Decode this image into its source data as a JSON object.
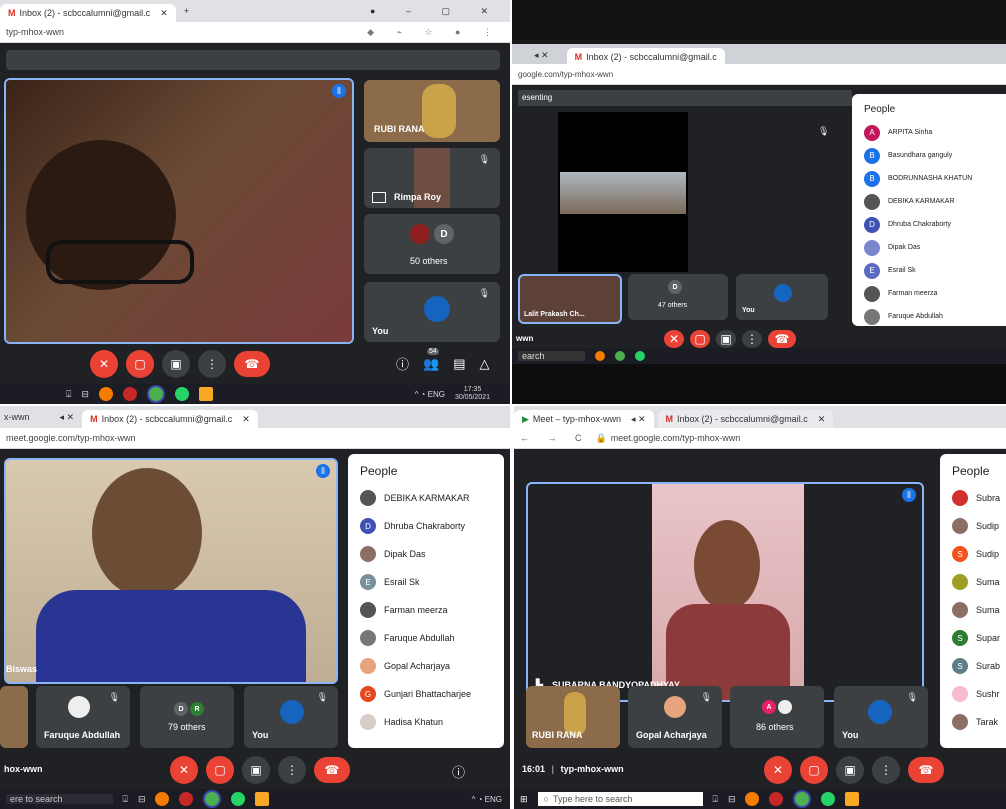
{
  "q1": {
    "tab_label": "Inbox (2) - scbccalumni@gmail.c",
    "tab_add": "+",
    "url": "typ-mhox-wwn",
    "tiles": [
      {
        "name": "RUBI RANA"
      },
      {
        "name": "Rimpa Roy"
      },
      {
        "name": "50 others",
        "avatar_letter": "D"
      },
      {
        "name": "You"
      }
    ],
    "people_badge": "54",
    "clock_time": "17:35",
    "clock_date": "30/05/2021"
  },
  "q2": {
    "tab_label": "Inbox (2) - scbccalumni@gmail.c",
    "url": "google.com/typ-mhox-wwn",
    "presenting": "esenting",
    "tiles": [
      {
        "name": "Lalit Prakash Ch..."
      },
      {
        "name": "47 others",
        "avatar_letter": "D"
      },
      {
        "name": "You"
      }
    ],
    "meeting_code": "wwn",
    "search": "earch",
    "people_title": "People",
    "people": [
      {
        "name": "ARPITA Sinha",
        "letter": "A",
        "color": "#c2185b"
      },
      {
        "name": "Basundhara ganguly",
        "letter": "B",
        "color": "#1a73e8"
      },
      {
        "name": "BODRUNNASHA KHATUN",
        "letter": "B",
        "color": "#1a73e8"
      },
      {
        "name": "DEBIKA KARMAKAR",
        "letter": "",
        "color": "#555555"
      },
      {
        "name": "Dhruba Chakraborty",
        "letter": "D",
        "color": "#3f51b5"
      },
      {
        "name": "Dipak Das",
        "letter": "",
        "color": "#7986cb"
      },
      {
        "name": "Esrail Sk",
        "letter": "E",
        "color": "#5c6bc0"
      },
      {
        "name": "Farman meerza",
        "letter": "",
        "color": "#555555"
      },
      {
        "name": "Faruque Abdullah",
        "letter": "",
        "color": "#777777"
      }
    ]
  },
  "q3": {
    "tab_label_left": "x-wwn",
    "tab_label": "Inbox (2) - scbccalumni@gmail.c",
    "url": "meet.google.com/typ-mhox-wwn",
    "main_name": "Biswas",
    "tiles": [
      {
        "name": "Faruque Abdullah"
      },
      {
        "name": "79 others",
        "avatar_letters": [
          "D",
          "R"
        ]
      },
      {
        "name": "You"
      }
    ],
    "meeting_code": "hox-wwn",
    "search": "ere to search",
    "people_title": "People",
    "people": [
      {
        "name": "DEBIKA KARMAKAR",
        "letter": "",
        "color": "#555555"
      },
      {
        "name": "Dhruba Chakraborty",
        "letter": "D",
        "color": "#3f51b5"
      },
      {
        "name": "Dipak Das",
        "letter": "",
        "color": "#8d6e63"
      },
      {
        "name": "Esrail Sk",
        "letter": "E",
        "color": "#78909c"
      },
      {
        "name": "Farman meerza",
        "letter": "",
        "color": "#555555"
      },
      {
        "name": "Faruque Abdullah",
        "letter": "",
        "color": "#777777"
      },
      {
        "name": "Gopal Acharjaya",
        "letter": "",
        "color": "#e6a57e"
      },
      {
        "name": "Gunjari Bhattacharjee",
        "letter": "G",
        "color": "#e8471d"
      },
      {
        "name": "Hadisa Khatun",
        "letter": "",
        "color": "#d7ccc8"
      }
    ]
  },
  "q4": {
    "tab_label_meet": "Meet – typ-mhox-wwn",
    "tab_label": "Inbox (2) - scbccalumni@gmail.c",
    "url": "meet.google.com/typ-mhox-wwn",
    "main_name": "SUBARNA BANDYOPADHYAY",
    "tiles": [
      {
        "name": "RUBI RANA"
      },
      {
        "name": "Gopal Acharjaya"
      },
      {
        "name": "86 others",
        "avatar_letter": "A"
      },
      {
        "name": "You"
      }
    ],
    "time": "16:01",
    "meeting_code": "typ-mhox-wwn",
    "search": "Type here to search",
    "people_title": "People",
    "people": [
      {
        "name": "Subra",
        "letter": "",
        "color": "#d32f2f"
      },
      {
        "name": "Sudip",
        "letter": "",
        "color": "#8d6e63"
      },
      {
        "name": "Sudip",
        "letter": "S",
        "color": "#f4511e"
      },
      {
        "name": "Suma",
        "letter": "",
        "color": "#9e9d24"
      },
      {
        "name": "Suma",
        "letter": "",
        "color": "#8d6e63"
      },
      {
        "name": "Supar",
        "letter": "S",
        "color": "#2e7d32"
      },
      {
        "name": "Surab",
        "letter": "S",
        "color": "#607d8b"
      },
      {
        "name": "Sushr",
        "letter": "",
        "color": "#f8bbd0"
      },
      {
        "name": "Tarak",
        "letter": "",
        "color": "#8d6e63"
      }
    ]
  },
  "colors": {
    "meet_bg": "#202124",
    "tile_bg": "#3c4043",
    "end_red": "#ea4335",
    "accent_blue": "#8ab4f8"
  },
  "icons": [
    "mic-off-icon",
    "camera-off-icon",
    "present-icon",
    "more-icon",
    "end-call-icon",
    "info-icon",
    "people-icon",
    "chat-icon",
    "activities-icon",
    "search-icon",
    "windows-icon"
  ]
}
